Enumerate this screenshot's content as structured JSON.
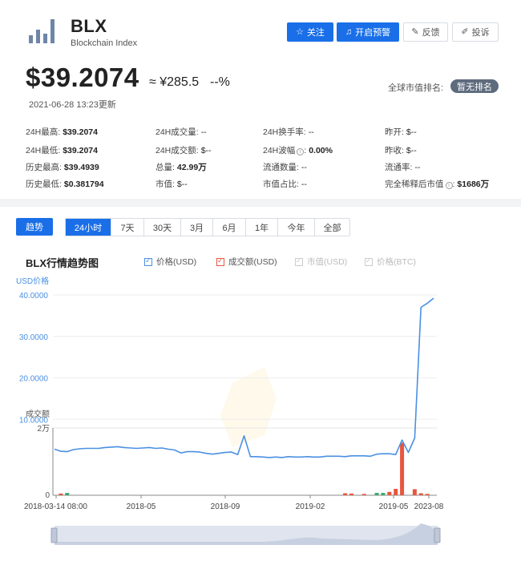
{
  "header": {
    "symbol": "BLX",
    "name": "Blockchain Index",
    "buttons": {
      "follow": "关注",
      "alert": "开启预警",
      "feedback": "反馈",
      "complain": "投诉"
    },
    "price": "$39.2074",
    "price_cny": "≈ ¥285.5",
    "change": "--%",
    "updated": "2021-06-28 13:23更新",
    "rank_label": "全球市值排名:",
    "rank_value": "暂无排名"
  },
  "stats": {
    "high24_label": "24H最高:",
    "high24": "$39.2074",
    "low24_label": "24H最低:",
    "low24": "$39.2074",
    "ath_label": "历史最高:",
    "ath": "$39.4939",
    "atl_label": "历史最低:",
    "atl": "$0.381794",
    "vol24_label": "24H成交量:",
    "vol24": "--",
    "amt24_label": "24H成交额:",
    "amt24": "$--",
    "supply_label": "总量:",
    "supply": "42.99万",
    "mcap_label": "市值:",
    "mcap": "$--",
    "turnover_label": "24H换手率:",
    "turnover": "--",
    "wave_label": "24H波幅",
    "wave": "0.00%",
    "circ_label": "流通数量:",
    "circ": "--",
    "mcap_share_label": "市值占比:",
    "mcap_share": "--",
    "open_label": "昨开:",
    "open": "$--",
    "close_label": "昨收:",
    "close": "$--",
    "circ_rate_label": "流通率:",
    "circ_rate": "--",
    "fdv_label": "完全稀释后市值",
    "fdv": "$1686万"
  },
  "tabs": {
    "trend": "趋势",
    "ranges": [
      "24小时",
      "7天",
      "30天",
      "3月",
      "6月",
      "1年",
      "今年",
      "全部"
    ],
    "active_range": "24小时"
  },
  "chart": {
    "title": "BLX行情趋势图",
    "legend": [
      {
        "label": "价格(USD)",
        "color": "#4a90e2",
        "checked": true
      },
      {
        "label": "成交额(USD)",
        "color": "#e8563f",
        "checked": true
      },
      {
        "label": "市值(USD)",
        "color": "#cccccc",
        "checked": false
      },
      {
        "label": "价格(BTC)",
        "color": "#cccccc",
        "checked": false
      }
    ],
    "price_axis_name": "USD价格",
    "volume_axis_name": "成交额",
    "volume_top_label": "2万",
    "volume_zero_label": "0"
  },
  "chart_data": {
    "type": "line",
    "title": "BLX行情趋势图",
    "x_ticks": [
      "2018-03-14 08:00",
      "2018-05",
      "2018-09",
      "2019-02",
      "2019-05",
      "2023-08"
    ],
    "y_ticks": [
      "40.0000",
      "30.0000",
      "20.0000",
      "10.0000"
    ],
    "ylim": [
      0,
      40
    ],
    "volume_ylim": [
      0,
      20000
    ],
    "series": [
      {
        "name": "价格(USD)",
        "color": "#4a90e2",
        "values": [
          2.8,
          2.3,
          2.2,
          2.7,
          2.9,
          3.0,
          3.0,
          3.0,
          3.2,
          3.3,
          3.4,
          3.2,
          3.1,
          3.0,
          3.1,
          3.2,
          3.0,
          3.1,
          2.8,
          2.6,
          1.9,
          2.2,
          2.2,
          2.1,
          1.8,
          1.6,
          1.8,
          2.0,
          2.1,
          1.5,
          6.0,
          1.0,
          1.0,
          0.9,
          0.8,
          0.9,
          0.8,
          1.0,
          0.9,
          0.9,
          1.0,
          0.9,
          0.9,
          1.1,
          1.1,
          1.1,
          1.0,
          1.2,
          1.2,
          1.2,
          1.1,
          1.6,
          1.7,
          1.7,
          1.5,
          5.0,
          2.0,
          5.5,
          37.0,
          38.0,
          39.2
        ]
      },
      {
        "name": "成交额(USD)",
        "color": "#e8563f",
        "values": [
          0,
          500,
          700,
          0,
          0,
          0,
          0,
          0,
          0,
          0,
          0,
          0,
          0,
          0,
          0,
          0,
          0,
          0,
          0,
          0,
          0,
          0,
          0,
          0,
          0,
          0,
          0,
          0,
          0,
          0,
          0,
          0,
          0,
          0,
          0,
          0,
          0,
          0,
          0,
          0,
          0,
          0,
          0,
          0,
          0,
          0,
          600,
          500,
          0,
          400,
          0,
          700,
          700,
          1000,
          1900,
          15600,
          0,
          1800,
          600,
          400,
          0
        ]
      }
    ]
  }
}
